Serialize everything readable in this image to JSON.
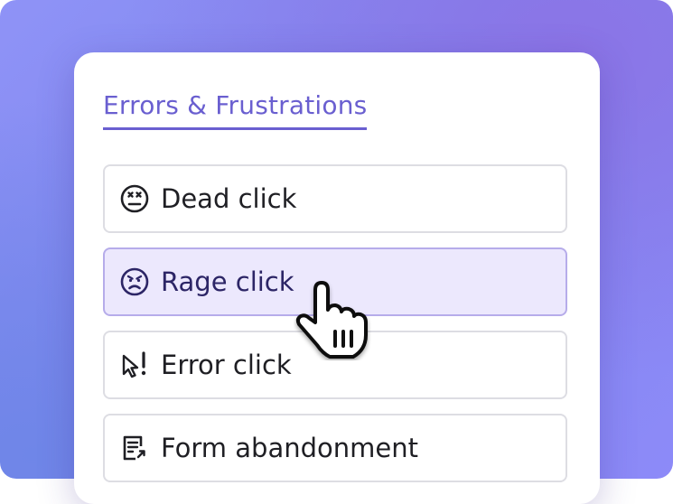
{
  "panel": {
    "title": "Errors & Frustrations",
    "items": [
      {
        "label": "Dead click",
        "icon": "dead-face-icon",
        "active": false
      },
      {
        "label": "Rage click",
        "icon": "angry-face-icon",
        "active": true
      },
      {
        "label": "Error click",
        "icon": "cursor-exclamation-icon",
        "active": false
      },
      {
        "label": "Form abandonment",
        "icon": "form-arrow-icon",
        "active": false
      }
    ]
  },
  "colors": {
    "accent": "#6a5fd0",
    "active_bg": "#ece8fd",
    "active_border": "#b6acea",
    "text": "#1f1f24",
    "background": "#8f93f7"
  }
}
